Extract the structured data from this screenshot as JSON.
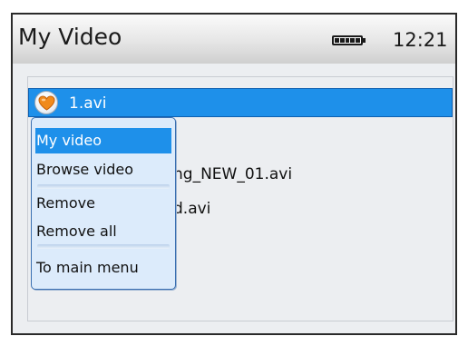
{
  "header": {
    "title": "My Video",
    "battery_icon": "battery-full-icon",
    "time": "12:21"
  },
  "file_list": {
    "items": [
      {
        "name": "1.avi",
        "icon": "heart-icon",
        "selected": true
      },
      {
        "name": "ng_NEW_01.avi",
        "selected": false
      },
      {
        "name": "d.avi",
        "selected": false
      }
    ]
  },
  "context_menu": {
    "items": [
      {
        "label": "My video",
        "active": true
      },
      {
        "label": "Browse video",
        "active": false
      },
      {
        "label": "Remove",
        "active": false
      },
      {
        "label": "Remove all",
        "active": false
      },
      {
        "label": "To main menu",
        "active": false
      }
    ]
  },
  "colors": {
    "selection": "#1e90ea",
    "menu_background": "#dcebfb",
    "menu_border": "#3a6fb1",
    "heart": "#f08a1c"
  }
}
